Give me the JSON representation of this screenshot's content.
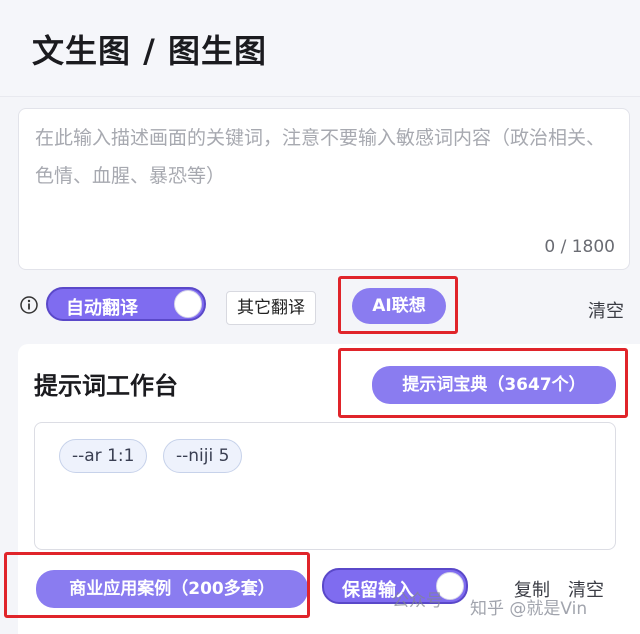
{
  "header": {
    "title": "文生图 / 图生图"
  },
  "prompt_input": {
    "placeholder": "在此输入描述画面的关键词，注意不要输入敏感词内容（政治相关、色情、血腥、暴恐等）",
    "counter": "0 / 1800"
  },
  "controls": {
    "auto_translate_label": "自动翻译",
    "auto_translate_on": true,
    "other_translate_label": "其它翻译",
    "ai_associate_label": "AI联想",
    "clear_label": "清空"
  },
  "workbench": {
    "title": "提示词工作台",
    "dictionary_button": "提示词宝典（3647个）",
    "tags": [
      "--ar 1:1",
      "--niji 5"
    ],
    "commercial_cases_button": "商业应用案例（200多套）",
    "keep_input_label": "保留输入",
    "keep_input_on": true,
    "copy_label": "复制",
    "clear_label": "清空"
  },
  "watermarks": [
    "公众号",
    "知乎 @就是Vin"
  ],
  "colors": {
    "accent": "#8a7cf0",
    "toggle_fill": "#7f6cf0",
    "highlight_red": "#e0242a",
    "tag_bg": "#eef2fc"
  }
}
